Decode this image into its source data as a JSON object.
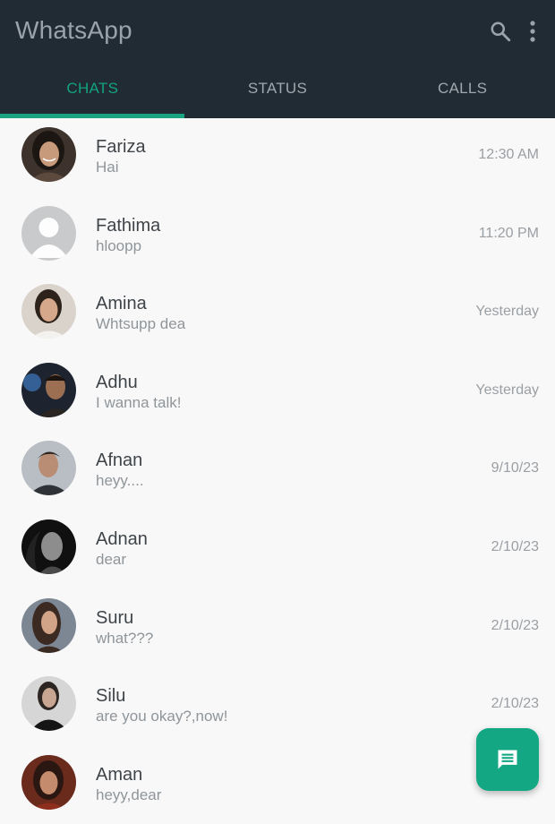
{
  "app": {
    "title": "WhatsApp"
  },
  "header_icons": [
    "search-icon",
    "more-vertical-icon"
  ],
  "tabs": [
    {
      "label": "CHATS",
      "active": true
    },
    {
      "label": "STATUS",
      "active": false
    },
    {
      "label": "CALLS",
      "active": false
    }
  ],
  "colors": {
    "appbar": "#212b34",
    "accent": "#19a582",
    "fab": "#13a784",
    "background": "#f8f8f9"
  },
  "chats": [
    {
      "name": "Fariza",
      "message": "Hai",
      "time": "12:30 AM",
      "avatar": "photo"
    },
    {
      "name": "Fathima",
      "message": "hloopp",
      "time": "11:20 PM",
      "avatar": "default-avatar-icon"
    },
    {
      "name": "Amina",
      "message": "Whtsupp dea",
      "time": "Yesterday",
      "avatar": "photo"
    },
    {
      "name": "Adhu",
      "message": "I wanna talk!",
      "time": "Yesterday",
      "avatar": "photo"
    },
    {
      "name": "Afnan",
      "message": "heyy....",
      "time": "9/10/23",
      "avatar": "photo"
    },
    {
      "name": "Adnan",
      "message": "dear",
      "time": "2/10/23",
      "avatar": "photo"
    },
    {
      "name": "Suru",
      "message": "what???",
      "time": "2/10/23",
      "avatar": "photo"
    },
    {
      "name": "Silu",
      "message": "are you okay?,now!",
      "time": "2/10/23",
      "avatar": "photo"
    },
    {
      "name": "Aman",
      "message": "heyy,dear",
      "time": "",
      "avatar": "photo"
    }
  ],
  "fab": {
    "icon": "new-chat-message-icon"
  }
}
